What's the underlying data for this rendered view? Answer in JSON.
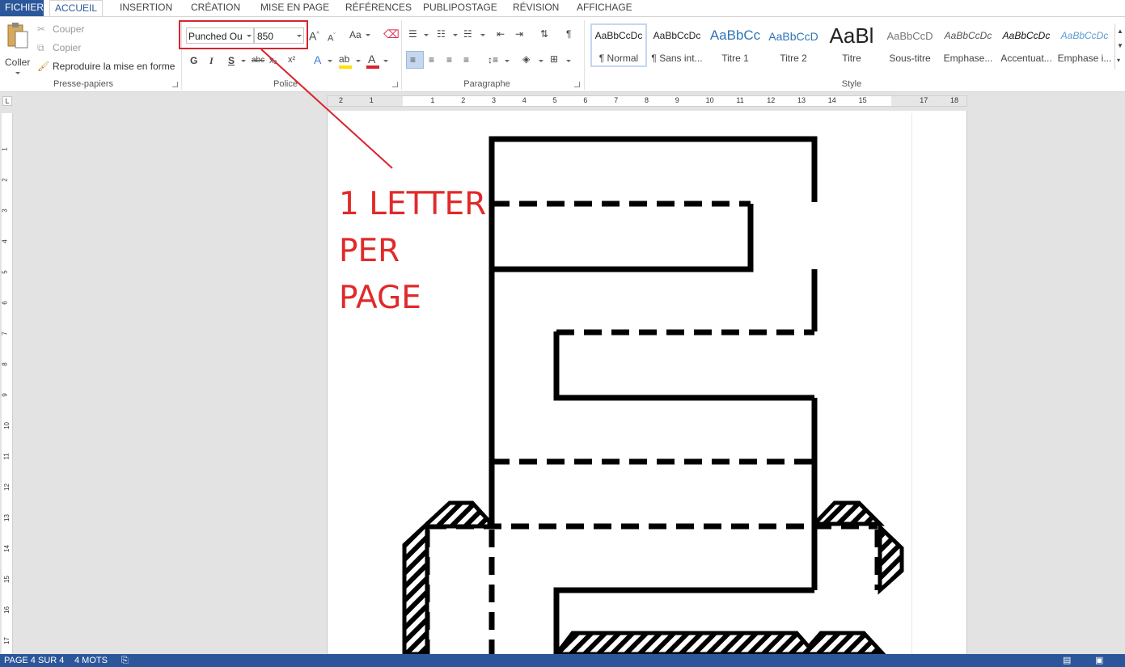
{
  "tabs": [
    "FICHIER",
    "ACCUEIL",
    "INSERTION",
    "CRÉATION",
    "MISE EN PAGE",
    "RÉFÉRENCES",
    "PUBLIPOSTAGE",
    "RÉVISION",
    "AFFICHAGE"
  ],
  "clipboard": {
    "paste_label": "Coller",
    "cut_label": "Couper",
    "copy_label": "Copier",
    "format_painter_label": "Reproduire la mise en forme",
    "group_label": "Presse-papiers"
  },
  "font": {
    "name": "Punched Ou",
    "size": "850",
    "group_label": "Police",
    "bold": "G",
    "italic": "I",
    "underline": "S",
    "strike": "abc",
    "sub": "x₂",
    "sup": "x²",
    "case": "Aa"
  },
  "paragraph": {
    "group_label": "Paragraphe"
  },
  "styles": {
    "group_label": "Style",
    "items": [
      {
        "preview": "AaBbCcDc",
        "name": "¶ Normal"
      },
      {
        "preview": "AaBbCcDc",
        "name": "¶ Sans int..."
      },
      {
        "preview": "AaBbCc",
        "name": "Titre 1"
      },
      {
        "preview": "AaBbCcD",
        "name": "Titre 2"
      },
      {
        "preview": "AaBl",
        "name": "Titre"
      },
      {
        "preview": "AaBbCcD",
        "name": "Sous-titre"
      },
      {
        "preview": "AaBbCcDc",
        "name": "Emphase..."
      },
      {
        "preview": "AaBbCcDc",
        "name": "Accentuat..."
      },
      {
        "preview": "AaBbCcDc",
        "name": "Emphase i..."
      }
    ]
  },
  "ruler_corner": "L",
  "ruler_top_labels": [
    "2",
    "1",
    "",
    "1",
    "2",
    "3",
    "4",
    "5",
    "6",
    "7",
    "8",
    "9",
    "10",
    "11",
    "12",
    "13",
    "14",
    "15",
    "",
    "17",
    "18"
  ],
  "ruler_left_labels": [
    "1",
    "2",
    "3",
    "4",
    "5",
    "6",
    "7",
    "8",
    "9",
    "10",
    "11",
    "12",
    "13",
    "14",
    "15",
    "16",
    "17"
  ],
  "annotation": [
    "1 LETTER",
    "PER",
    "PAGE"
  ],
  "status": {
    "page": "PAGE 4 SUR 4",
    "words": "4 MOTS"
  },
  "colors": {
    "accent": "#2b579a",
    "annotation": "#e02a2a",
    "highlight_box": "#d9232d",
    "letter_stroke": "#000000"
  }
}
